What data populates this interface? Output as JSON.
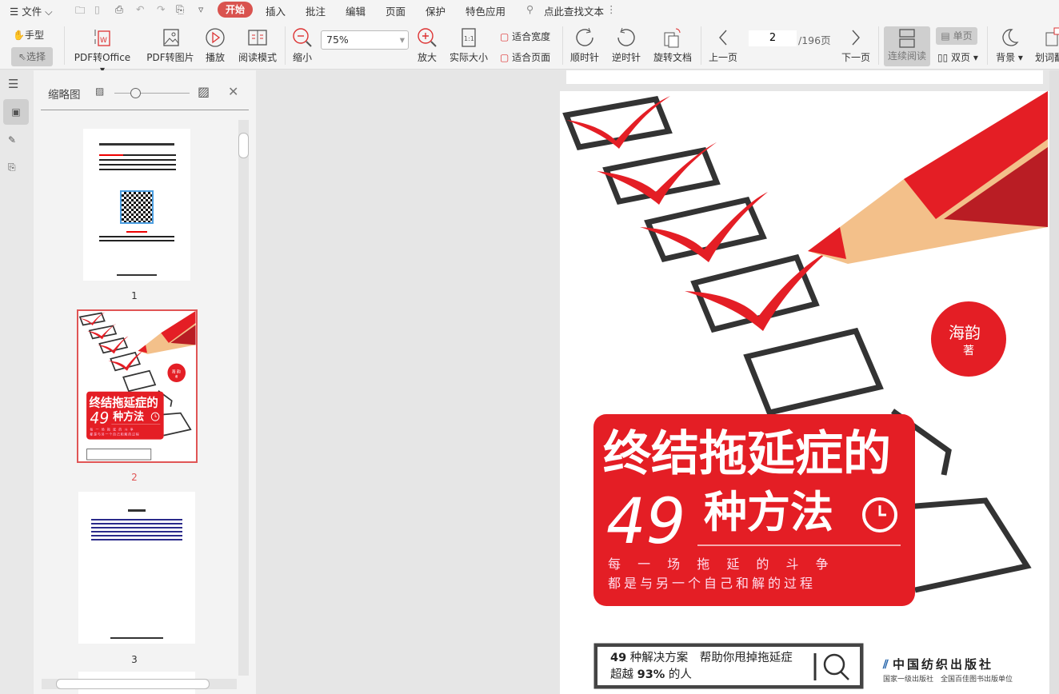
{
  "menu": {
    "file": "文件",
    "tabs": [
      "开始",
      "插入",
      "批注",
      "编辑",
      "页面",
      "保护",
      "特色应用"
    ],
    "active_tab": "开始",
    "search": "点此查找文本"
  },
  "toolbar": {
    "hand": "手型",
    "select": "选择",
    "pdf_to_office": "PDF转Office",
    "pdf_to_image": "PDF转图片",
    "play": "播放",
    "read_mode": "阅读模式",
    "zoom_out": "缩小",
    "zoom_value": "75%",
    "zoom_in": "放大",
    "actual_size": "实际大小",
    "fit_width": "适合宽度",
    "fit_page": "适合页面",
    "clockwise": "顺时针",
    "counterclockwise": "逆时针",
    "rotate_doc": "旋转文档",
    "prev_page": "上一页",
    "current_page": "2",
    "total_pages": "/196页",
    "next_page": "下一页",
    "continuous": "连续阅读",
    "single": "单页",
    "double": "双页",
    "background": "背景",
    "translate": "划词翻译"
  },
  "sidebar": {
    "title": "缩略图",
    "pages": [
      "1",
      "2",
      "3"
    ],
    "selected_page": "2"
  },
  "cover": {
    "title_line1": "终结拖延症的",
    "title_num": "49",
    "title_line2": "种方法",
    "sub1": "每 一 场 拖 延 的 斗 争",
    "sub2": "都是与另一个自己和解的过程",
    "author": "海韵",
    "author_suffix": "著",
    "blurb1_num": "49",
    "blurb1": " 种解决方案　帮助你甩掉拖延症",
    "blurb2_a": "超越 ",
    "blurb2_num": "93%",
    "blurb2_b": " 的人",
    "publisher": "中国纺织出版社",
    "publisher_sub": "国家一级出版社　全国百佳图书出版单位"
  },
  "colors": {
    "accent": "#d9534f",
    "cover_red": "#e41e25"
  }
}
